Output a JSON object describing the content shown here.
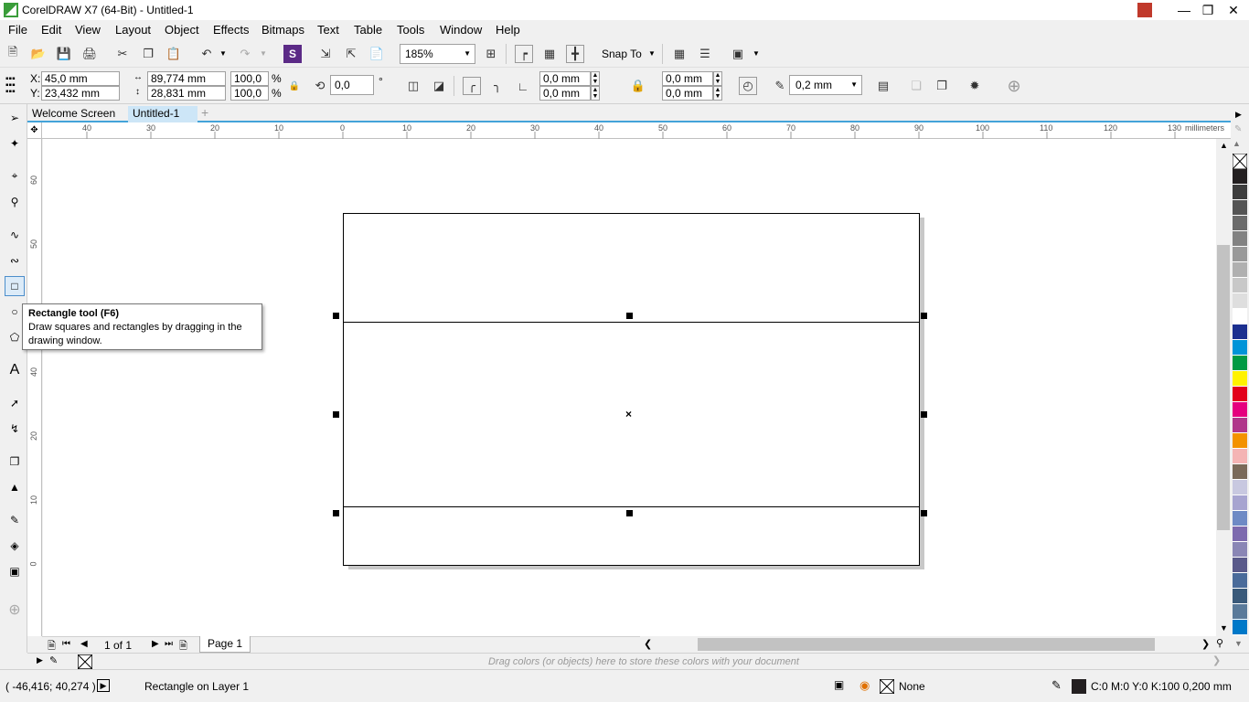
{
  "window": {
    "title": "CorelDRAW X7 (64-Bit) - Untitled-1"
  },
  "menu": [
    "File",
    "Edit",
    "View",
    "Layout",
    "Object",
    "Effects",
    "Bitmaps",
    "Text",
    "Table",
    "Tools",
    "Window",
    "Help"
  ],
  "standard_toolbar": {
    "zoom": "185%",
    "snap_to": "Snap To"
  },
  "property_bar": {
    "x": "45,0 mm",
    "y": "23,432 mm",
    "x_label": "X:",
    "y_label": "Y:",
    "width": "89,774 mm",
    "height": "28,831 mm",
    "scale_w": "100,0",
    "scale_h": "100,0",
    "percent": "%",
    "rotation": "0,0",
    "degree": "°",
    "corner_tl": "0,0 mm",
    "corner_bl": "0,0 mm",
    "corner_tr": "0,0 mm",
    "corner_br": "0,0 mm",
    "outline_width": "0,2 mm"
  },
  "tabs": [
    {
      "label": "Welcome Screen",
      "active": false
    },
    {
      "label": "Untitled-1",
      "active": true
    }
  ],
  "ruler": {
    "h_labels": [
      "40",
      "30",
      "20",
      "10",
      "0",
      "10",
      "20",
      "30",
      "40",
      "50",
      "60",
      "70",
      "80",
      "90",
      "100",
      "110",
      "120",
      "130"
    ],
    "units": "millimeters",
    "v_labels": [
      "60",
      "50",
      "40",
      "30",
      "20",
      "10",
      "0"
    ]
  },
  "tooltip": {
    "title": "Rectangle tool (F6)",
    "body": "Draw squares and rectangles by dragging in the drawing window."
  },
  "page_nav": {
    "page_count": "1 of 1",
    "page_tab": "Page 1"
  },
  "doc_palette": {
    "hint": "Drag colors (or objects) here to store these colors with your document"
  },
  "status": {
    "coords": "( -46,416; 40,274 )",
    "selection": "Rectangle on Layer 1",
    "fill": "None",
    "outline": "C:0 M:0 Y:0 K:100  0,200 mm"
  },
  "palette_colors": [
    "#231f20",
    "#3d3d3d",
    "#545454",
    "#6b6b6b",
    "#828282",
    "#999999",
    "#b0b0b0",
    "#c8c8c8",
    "#dedede",
    "#ffffff",
    "#1b2f8f",
    "#0094d8",
    "#009a44",
    "#fff200",
    "#e2001a",
    "#e5007e",
    "#b0378b",
    "#f39200",
    "#f4b4b4",
    "#7a6a5a",
    "#c8c8e0",
    "#a7a4d0",
    "#6e8ac5",
    "#7d6aae",
    "#8a86b5",
    "#5a5a8a",
    "#4a6b9a",
    "#3a5a7a",
    "#5a7a9a",
    "#0078c8"
  ]
}
